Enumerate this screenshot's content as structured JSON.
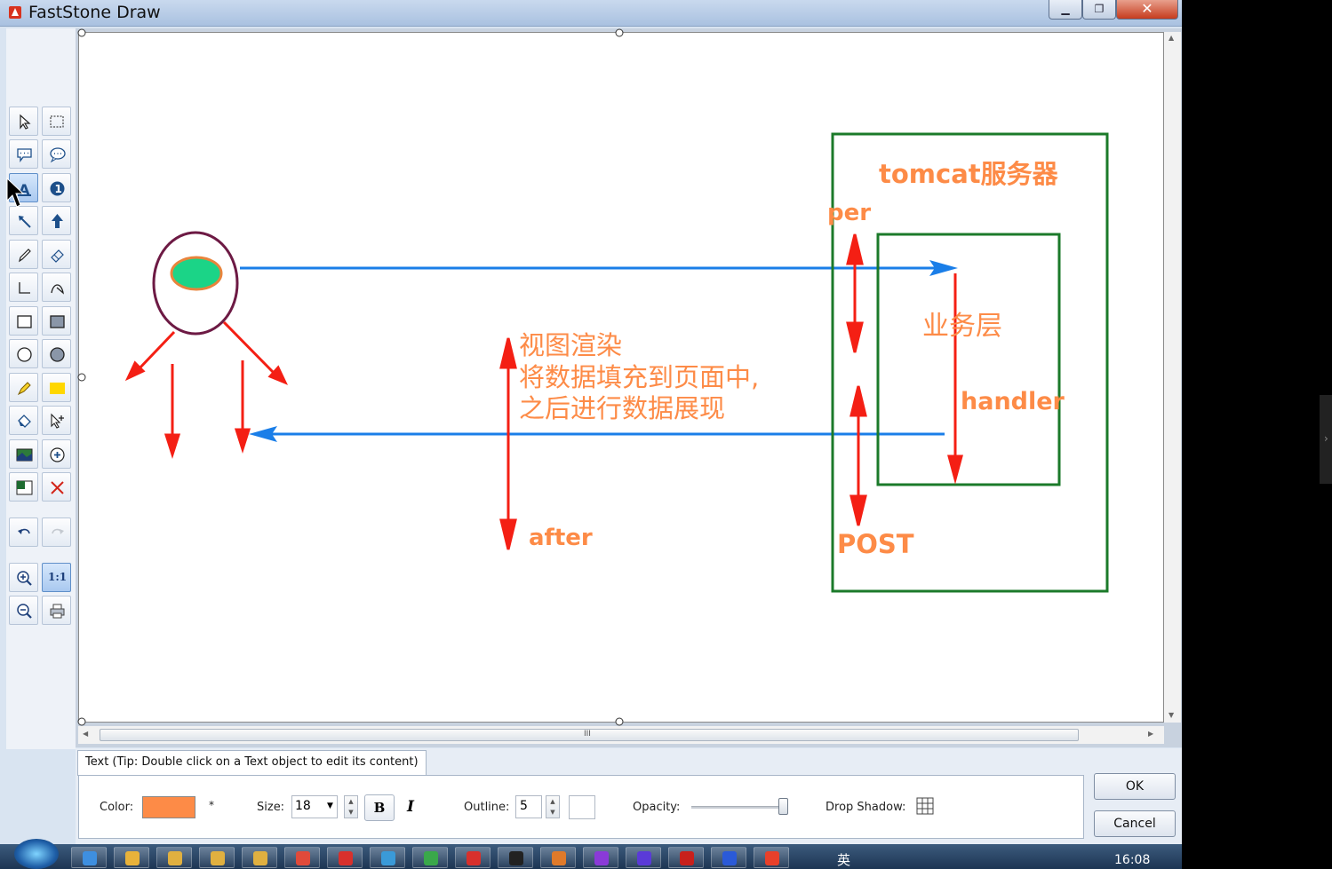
{
  "window": {
    "title": "FastStone Draw",
    "buttons": {
      "minimize": "▁",
      "maximize": "❐",
      "close": "✕"
    }
  },
  "tools": [
    "select-arrow",
    "select-rectangle",
    "callout-rect",
    "callout-round",
    "text",
    "numbered-step",
    "line-arrow",
    "thick-arrow",
    "pen",
    "eraser",
    "line",
    "curve",
    "rectangle",
    "rectangle-filled",
    "ellipse",
    "ellipse-filled",
    "highlighter",
    "highlight-rect",
    "fill",
    "cursor-insert",
    "image",
    "zoom-circle",
    "watermark",
    "delete",
    "undo",
    "redo",
    "zoom-in",
    "actual-size",
    "zoom-out",
    "print"
  ],
  "actual_size_label": "1:1",
  "drawing": {
    "server_label": "tomcat服务器",
    "per_label": "per",
    "business_label": "业务层",
    "handler_label": "handler",
    "after_label": "after",
    "post_label": "POST",
    "note_line1": "视图渲染",
    "note_line2": "将数据填充到页面中,",
    "note_line3": "之后进行数据展现",
    "colors": {
      "text_orange": "#fd8b47",
      "arrow_red": "#f41f14",
      "arrow_blue": "#1a7ee8",
      "box_green": "#1b7a2a",
      "head_purple": "#6d1a44",
      "head_fill": "#1bd487",
      "head_outline": "#e8843c"
    }
  },
  "scrollbar": {
    "thumb_grip": "III"
  },
  "properties": {
    "tab_label": "Text (Tip: Double click on a Text object to edit its content)",
    "color_label": "Color:",
    "color_value": "#fd8b47",
    "color_marker": "*",
    "size_label": "Size:",
    "size_value": "18",
    "bold_label": "B",
    "italic_label": "I",
    "outline_label": "Outline:",
    "outline_value": "5",
    "opacity_label": "Opacity:",
    "opacity_value": 1.0,
    "drop_shadow_label": "Drop Shadow:",
    "ok_label": "OK",
    "cancel_label": "Cancel"
  },
  "taskbar": {
    "ime_label": "英",
    "clock": "16:08",
    "items": [
      "ie",
      "explorer",
      "folder-1",
      "folder-2",
      "folder-3",
      "chrome",
      "video",
      "screen",
      "green-app",
      "red-app",
      "cmd",
      "java",
      "notes",
      "eclipse",
      "filezilla",
      "word",
      "color-app"
    ]
  }
}
